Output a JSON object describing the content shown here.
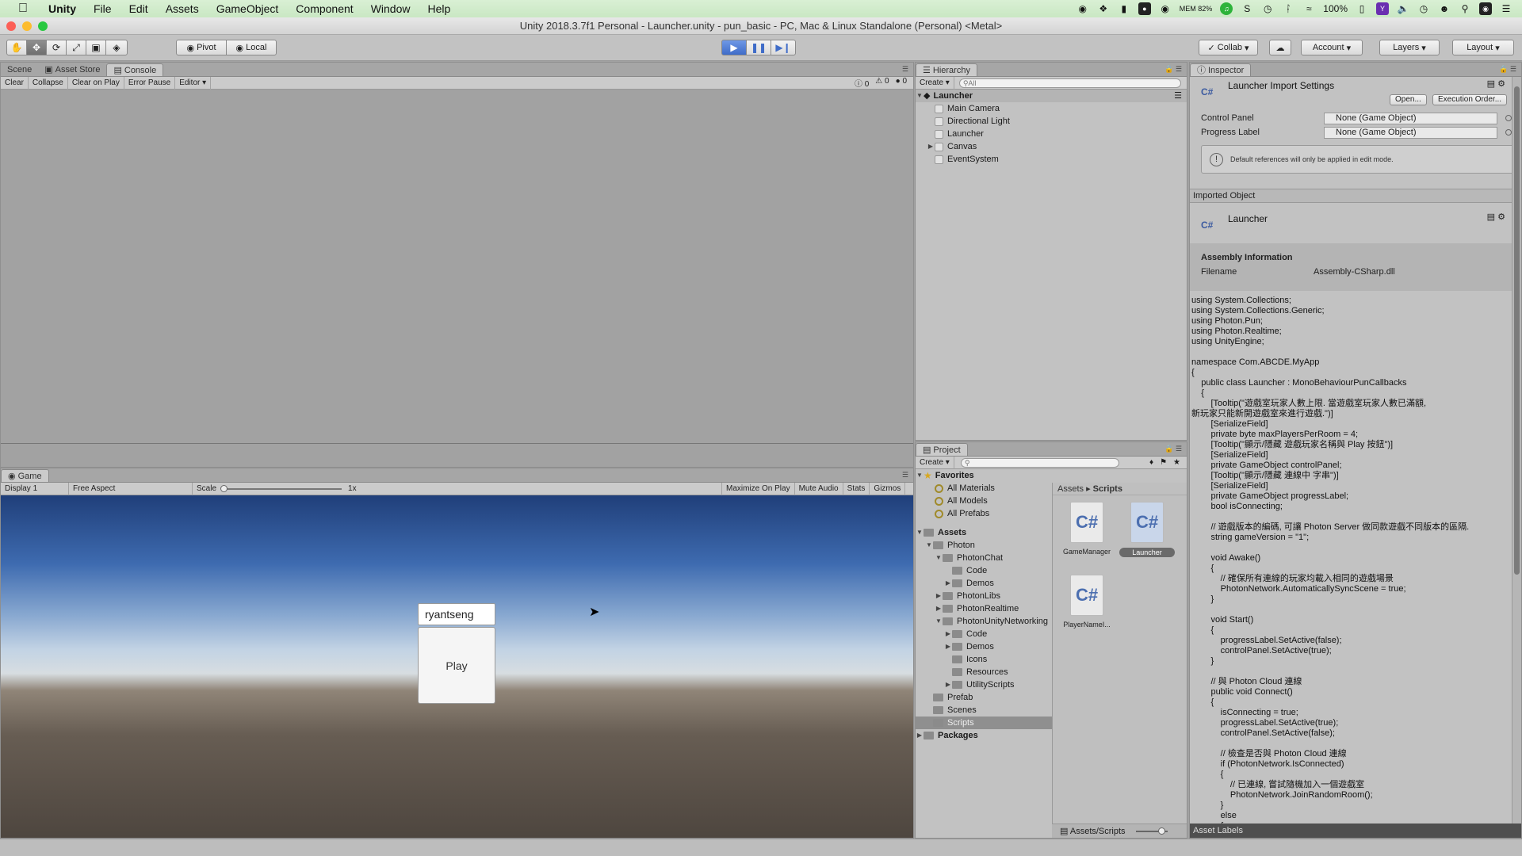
{
  "menubar": {
    "items": [
      "Unity",
      "File",
      "Edit",
      "Assets",
      "GameObject",
      "Component",
      "Window",
      "Help"
    ],
    "tray": {
      "mem": "MEM 82%",
      "battery": "100%"
    }
  },
  "window": {
    "title": "Unity 2018.3.7f1 Personal - Launcher.unity - pun_basic - PC, Mac & Linux Standalone (Personal) <Metal>"
  },
  "toolbar": {
    "pivot": "Pivot",
    "local": "Local",
    "collab": "Collab",
    "account": "Account",
    "layers": "Layers",
    "layout": "Layout"
  },
  "console": {
    "tabs": [
      "Scene",
      "Asset Store",
      "Console"
    ],
    "buttons": [
      "Clear",
      "Collapse",
      "Clear on Play",
      "Error Pause",
      "Editor"
    ],
    "counts": [
      "0",
      "0",
      "0"
    ]
  },
  "game": {
    "tab": "Game",
    "display": "Display 1",
    "aspect": "Free Aspect",
    "scale_label": "Scale",
    "scale_value": "1x",
    "buttons": [
      "Maximize On Play",
      "Mute Audio",
      "Stats",
      "Gizmos"
    ],
    "name_input_value": "ryantseng",
    "play_label": "Play"
  },
  "hierarchy": {
    "tab": "Hierarchy",
    "create": "Create",
    "search_placeholder": "All",
    "scene": "Launcher",
    "items": [
      "Main Camera",
      "Directional Light",
      "Launcher",
      "Canvas",
      "EventSystem"
    ]
  },
  "project": {
    "tab": "Project",
    "create": "Create",
    "favorites_label": "Favorites",
    "favorites": [
      "All Materials",
      "All Models",
      "All Prefabs"
    ],
    "assets_label": "Assets",
    "tree": [
      {
        "label": "Photon",
        "depth": 1,
        "arrow": "down"
      },
      {
        "label": "PhotonChat",
        "depth": 2,
        "arrow": "down"
      },
      {
        "label": "Code",
        "depth": 3,
        "arrow": ""
      },
      {
        "label": "Demos",
        "depth": 3,
        "arrow": "right"
      },
      {
        "label": "PhotonLibs",
        "depth": 2,
        "arrow": "right"
      },
      {
        "label": "PhotonRealtime",
        "depth": 2,
        "arrow": "right"
      },
      {
        "label": "PhotonUnityNetworking",
        "depth": 2,
        "arrow": "down"
      },
      {
        "label": "Code",
        "depth": 3,
        "arrow": "right"
      },
      {
        "label": "Demos",
        "depth": 3,
        "arrow": "right"
      },
      {
        "label": "Icons",
        "depth": 3,
        "arrow": ""
      },
      {
        "label": "Resources",
        "depth": 3,
        "arrow": ""
      },
      {
        "label": "UtilityScripts",
        "depth": 3,
        "arrow": "right"
      },
      {
        "label": "Prefab",
        "depth": 1,
        "arrow": ""
      },
      {
        "label": "Scenes",
        "depth": 1,
        "arrow": ""
      },
      {
        "label": "Scripts",
        "depth": 1,
        "arrow": "",
        "selected": true
      }
    ],
    "packages_label": "Packages",
    "breadcrumb": [
      "Assets",
      "Scripts"
    ],
    "assets": [
      "GameManager",
      "Launcher",
      "PlayerNameI..."
    ],
    "footer_path": "Assets/Scripts"
  },
  "inspector": {
    "tab": "Inspector",
    "title": "Launcher Import Settings",
    "open_btn": "Open...",
    "exec_btn": "Execution Order...",
    "fields": [
      {
        "label": "Control Panel",
        "value": "None (Game Object)"
      },
      {
        "label": "Progress Label",
        "value": "None (Game Object)"
      }
    ],
    "help_text": "Default references will only be applied in edit mode.",
    "imported_object": "Imported Object",
    "object_name": "Launcher",
    "assembly_header": "Assembly Information",
    "filename_label": "Filename",
    "filename_value": "Assembly-CSharp.dll",
    "asset_labels": "Asset Labels",
    "code": "using System.Collections;\nusing System.Collections.Generic;\nusing Photon.Pun;\nusing Photon.Realtime;\nusing UnityEngine;\n\nnamespace Com.ABCDE.MyApp\n{\n    public class Launcher : MonoBehaviourPunCallbacks\n    {\n        [Tooltip(\"遊戲室玩家人數上限. 當遊戲室玩家人數已滿額,\n新玩家只能新開遊戲室來進行遊戲.\")]\n        [SerializeField]\n        private byte maxPlayersPerRoom = 4;\n        [Tooltip(\"顯示/隱藏 遊戲玩家名稱與 Play 按鈕\")]\n        [SerializeField]\n        private GameObject controlPanel;\n        [Tooltip(\"顯示/隱藏 連線中 字串\")]\n        [SerializeField]\n        private GameObject progressLabel;\n        bool isConnecting;\n\n        // 遊戲版本的編碼, 可讓 Photon Server 做同款遊戲不同版本的區隔.\n        string gameVersion = \"1\";\n\n        void Awake()\n        {\n            // 確保所有連線的玩家均載入相同的遊戲場景\n            PhotonNetwork.AutomaticallySyncScene = true;\n        }\n\n        void Start()\n        {\n            progressLabel.SetActive(false);\n            controlPanel.SetActive(true);\n        }\n\n        // 與 Photon Cloud 連線\n        public void Connect()\n        {\n            isConnecting = true;\n            progressLabel.SetActive(true);\n            controlPanel.SetActive(false);\n\n            // 檢查是否與 Photon Cloud 連線\n            if (PhotonNetwork.IsConnected)\n            {\n                // 已連線, 嘗試隨機加入一個遊戲室\n                PhotonNetwork.JoinRandomRoom();\n            }\n            else\n            {\n                // 未連線, 嘗試與 Photon Cloud 連線"
  }
}
